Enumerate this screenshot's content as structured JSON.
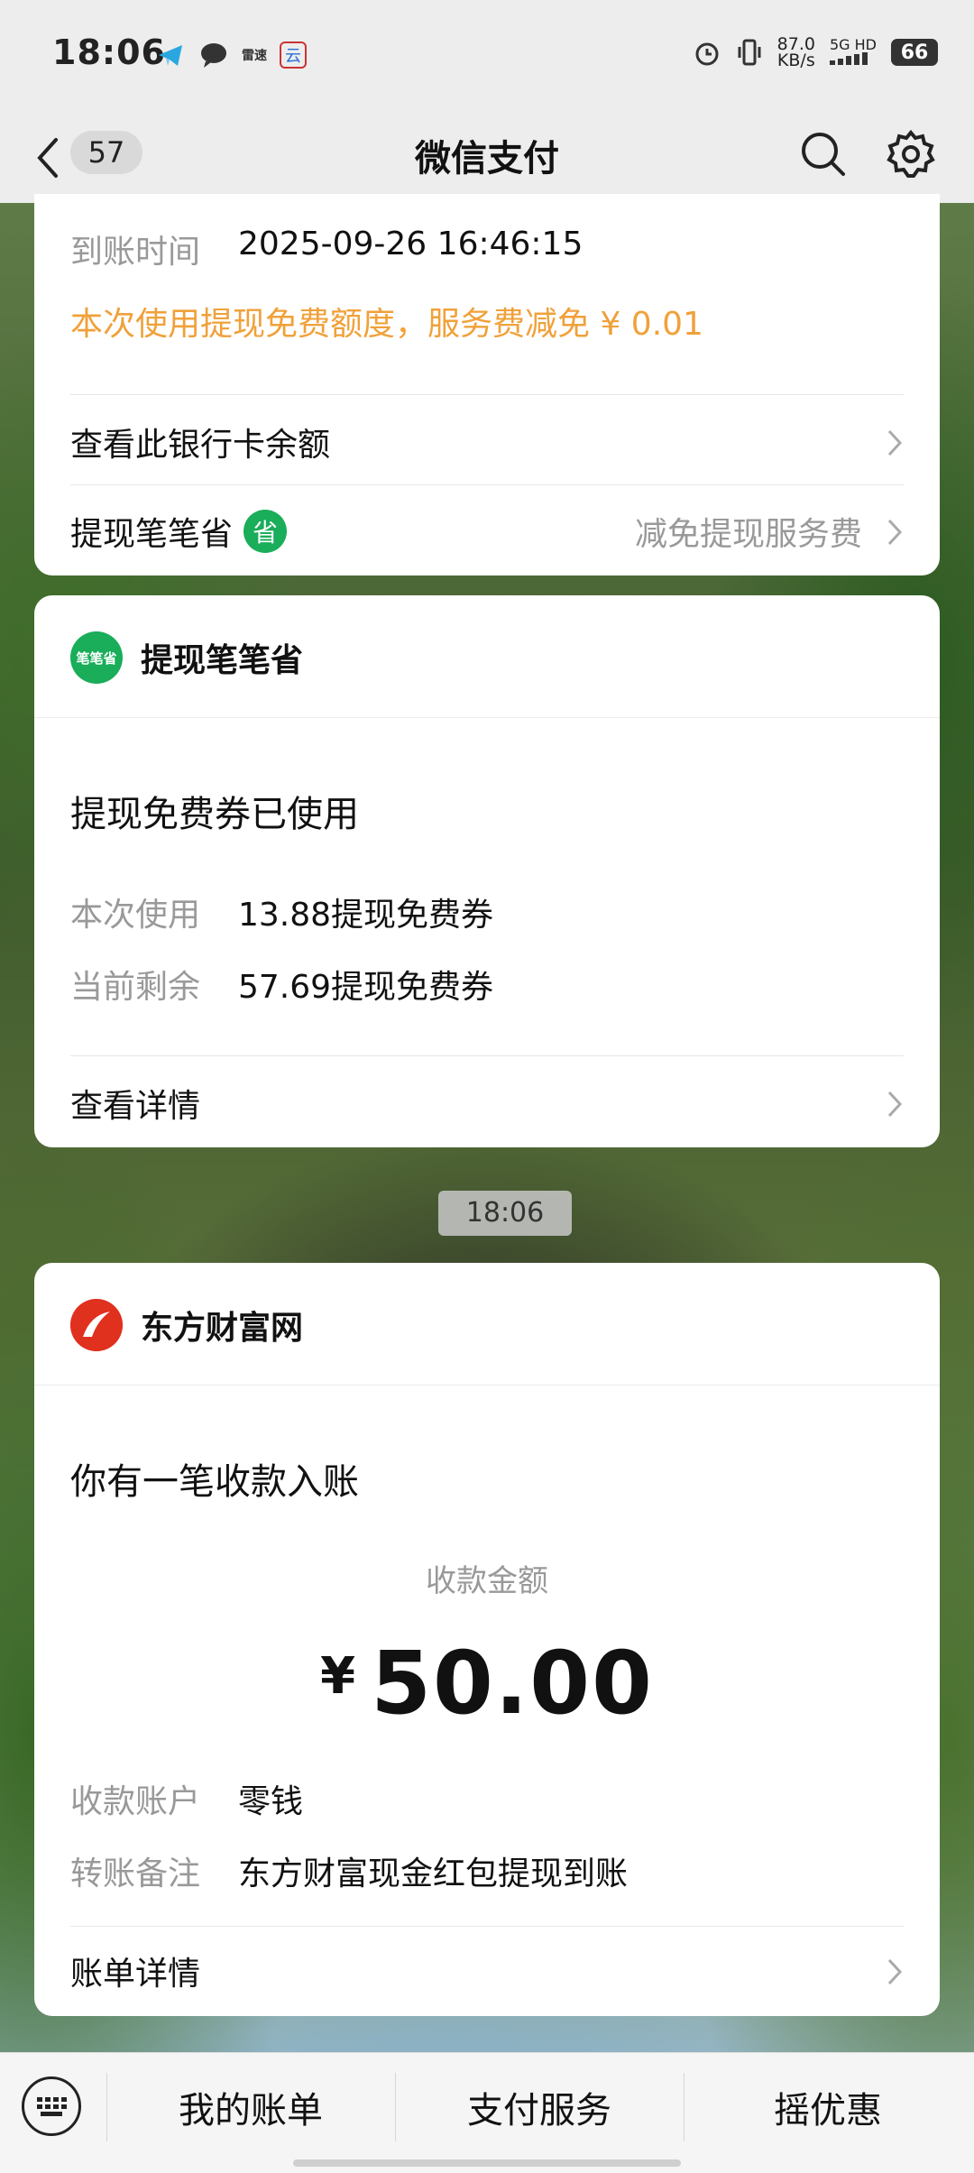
{
  "status_bar": {
    "time": "18:06",
    "app_icon_1": "telegram-icon",
    "app_icon_2": "chat-bubble-icon",
    "app_icon_3_text": "雷速",
    "app_icon_4_text": "云",
    "speed_value": "87.0",
    "speed_unit": "KB/s",
    "network": "5G HD",
    "battery": "66"
  },
  "nav": {
    "unread_count": "57",
    "title": "微信支付"
  },
  "card1": {
    "arrival_label": "到账时间",
    "arrival_value": "2025-09-26 16:46:15",
    "notice": "本次使用提现免费额度，服务费减免 ¥ 0.01",
    "bank_balance_link": "查看此银行卡余额",
    "saver_label": "提现笔笔省",
    "saver_badge": "省",
    "saver_right": "减免提现服务费"
  },
  "card2": {
    "brand_logo_text": "笔笔省",
    "brand": "提现笔笔省",
    "headline": "提现免费券已使用",
    "used_label": "本次使用",
    "used_value": "13.88提现免费券",
    "remain_label": "当前剩余",
    "remain_value": "57.69提现免费券",
    "detail_link": "查看详情"
  },
  "timestamp": "18:06",
  "card3": {
    "brand": "东方财富网",
    "headline": "你有一笔收款入账",
    "amount_label": "收款金额",
    "currency": "¥",
    "amount": "50.00",
    "account_label": "收款账户",
    "account_value": "零钱",
    "memo_label": "转账备注",
    "memo_value": "东方财富现金红包提现到账",
    "bill_link": "账单详情"
  },
  "bottom_bar": {
    "tabs": [
      "我的账单",
      "支付服务",
      "摇优惠"
    ]
  },
  "colors": {
    "accent_orange": "#f0a13a",
    "wechat_green": "#1aad5a",
    "eastmoney_red": "#e0301e"
  }
}
